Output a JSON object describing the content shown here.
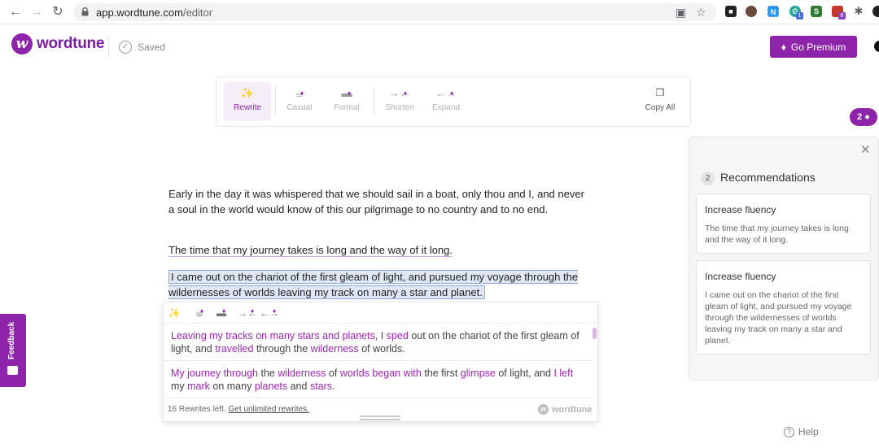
{
  "browser": {
    "url_host": "app.wordtune.com",
    "url_path": "/editor",
    "extension_badges": [
      "1",
      "8"
    ]
  },
  "header": {
    "logo_letter": "w",
    "brand": "wordtune",
    "saved_label": "Saved",
    "premium_label": "Go Premium"
  },
  "toolbar": {
    "rewrite": "Rewrite",
    "casual": "Casual",
    "formal": "Formal",
    "shorten": "Shorten",
    "expand": "Expand",
    "copy_all": "Copy All"
  },
  "document": {
    "paragraph1": "Early in the day it was whispered that we should sail in a boat, only thou and I, and never a soul in the world would know of this our pilgrimage to no country and to no end.",
    "paragraph2": "The time that my journey takes is long and the way of it long.",
    "paragraph3": "I came out on the chariot of the first gleam of light, and pursued my voyage through the wildernesses of worlds leaving my track on many a star and planet."
  },
  "rewrite_popup": {
    "suggestion1": [
      {
        "t": "Leaving my tracks on many stars and planets",
        "h": true
      },
      {
        "t": ", I ",
        "h": false
      },
      {
        "t": "sped",
        "h": true
      },
      {
        "t": " out on the chariot of the first gleam of light, and ",
        "h": false
      },
      {
        "t": "travelled",
        "h": true
      },
      {
        "t": " through the ",
        "h": false
      },
      {
        "t": "wilderness",
        "h": true
      },
      {
        "t": " of worlds.",
        "h": false
      }
    ],
    "suggestion2": [
      {
        "t": "My journey through",
        "h": true
      },
      {
        "t": " the ",
        "h": false
      },
      {
        "t": "wilderness",
        "h": true
      },
      {
        "t": " of ",
        "h": false
      },
      {
        "t": "worlds began with",
        "h": true
      },
      {
        "t": " the first ",
        "h": false
      },
      {
        "t": "glimpse",
        "h": true
      },
      {
        "t": " of light, and ",
        "h": false
      },
      {
        "t": "I left",
        "h": true
      },
      {
        "t": " my ",
        "h": false
      },
      {
        "t": "mark",
        "h": true
      },
      {
        "t": " on many ",
        "h": false
      },
      {
        "t": "planets",
        "h": true
      },
      {
        "t": " and ",
        "h": false
      },
      {
        "t": "stars",
        "h": true
      },
      {
        "t": ".",
        "h": false
      }
    ],
    "rewrites_left": "16 Rewrites left.",
    "unlimited_link": "Get unlimited rewrites.",
    "brand": "wordtune"
  },
  "recommendations_badge": "2",
  "recommendations": {
    "count": "2",
    "title": "Recommendations",
    "items": [
      {
        "title": "Increase fluency",
        "text": "The time that my journey takes is long and the way of it long."
      },
      {
        "title": "Increase fluency",
        "text": "I came out on the chariot of the first gleam of light, and pursued my voyage through the wildernesses of worlds leaving my track on many a star and planet."
      }
    ]
  },
  "feedback_label": "Feedback",
  "help_label": "Help",
  "colors": {
    "brand": "#8e24aa",
    "highlight_selection": "#dfe6f4",
    "suggestion_change": "#9c27b0"
  }
}
